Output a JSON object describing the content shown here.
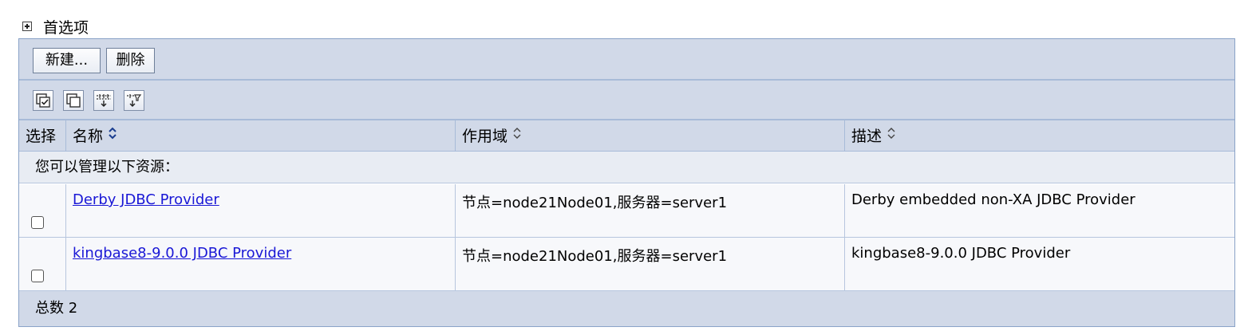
{
  "preferences": {
    "label": "首选项",
    "toggle_icon": "expand-plus-icon"
  },
  "toolbar": {
    "new_label": "新建...",
    "delete_label": "删除"
  },
  "icon_toolbar": [
    {
      "name": "select-all-icon"
    },
    {
      "name": "deselect-all-icon"
    },
    {
      "name": "show-filter-icon"
    },
    {
      "name": "clear-filter-icon"
    }
  ],
  "table": {
    "columns": [
      {
        "label": "选择",
        "sort": "none"
      },
      {
        "label": "名称",
        "sort": "active"
      },
      {
        "label": "作用域",
        "sort": "inactive"
      },
      {
        "label": "描述",
        "sort": "inactive"
      }
    ],
    "caption": "您可以管理以下资源：",
    "rows": [
      {
        "selected": false,
        "name": "Derby JDBC Provider",
        "scope": "节点=node21Node01,服务器=server1",
        "description": "Derby embedded non-XA JDBC Provider"
      },
      {
        "selected": false,
        "name": "kingbase8-9.0.0 JDBC Provider",
        "scope": "节点=node21Node01,服务器=server1",
        "description": "kingbase8-9.0.0 JDBC Provider"
      }
    ],
    "footer_label": "总数 2"
  },
  "colors": {
    "bar": "#d1d9e8",
    "border": "#8aa3c8",
    "link": "#1a18d6"
  }
}
